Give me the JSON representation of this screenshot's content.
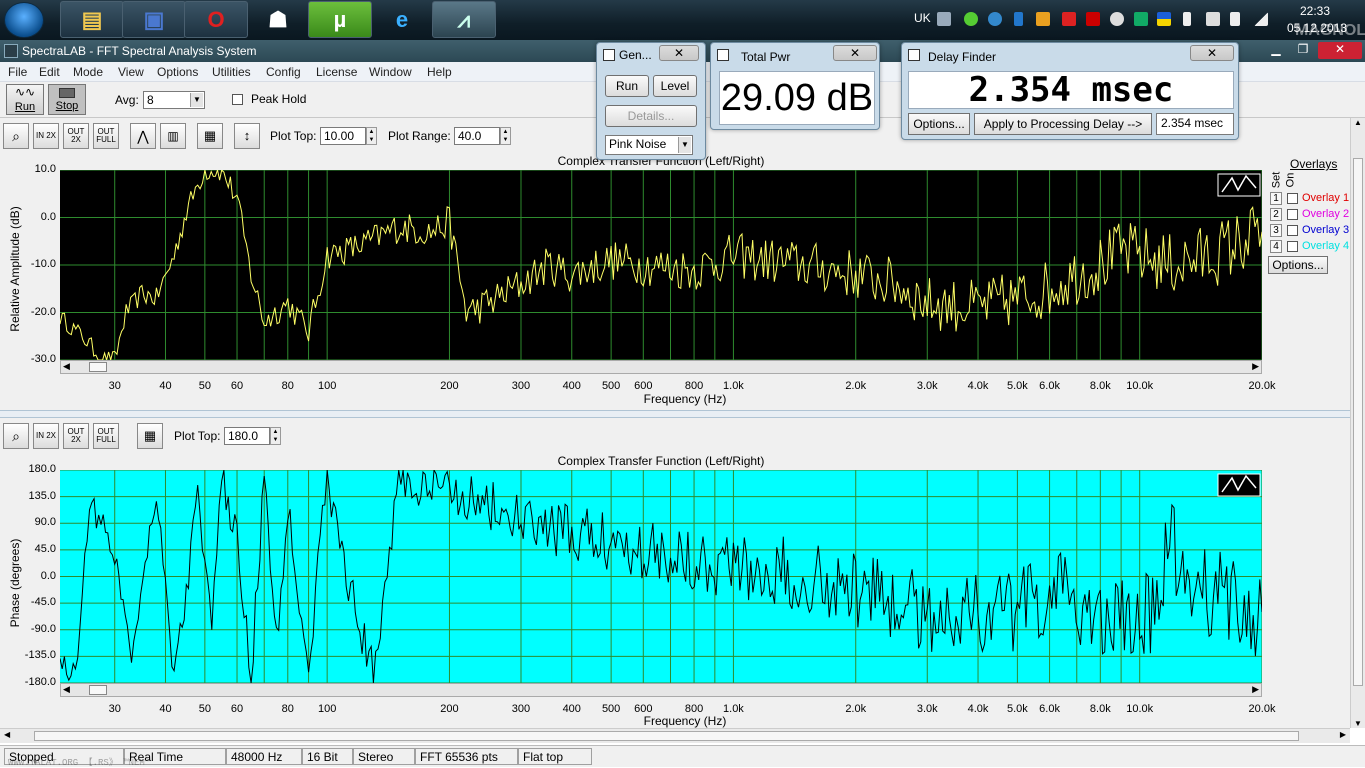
{
  "taskbar": {
    "clock_time": "22:33",
    "clock_date": "05.12.2013",
    "lang": "UK",
    "watermark": "MAGNOLIA"
  },
  "app": {
    "title": "SpectraLAB - FFT Spectral Analysis System"
  },
  "menu": [
    "File",
    "Edit",
    "Mode",
    "View",
    "Options",
    "Utilities",
    "Config",
    "License",
    "Window",
    "Help"
  ],
  "toolbar": {
    "run_label": "Run",
    "stop_label": "Stop",
    "avg_label": "Avg:",
    "avg_value": "8",
    "peak_hold_label": "Peak Hold",
    "plot_top_label": "Plot Top:",
    "plot_top_value": "10.00",
    "plot_range_label": "Plot Range:",
    "plot_range_value": "40.0",
    "plot2_top_value": "180.0",
    "zoom_in": "IN 2X",
    "zoom_out": "OUT 2X",
    "zoom_full": "OUT FULL"
  },
  "plot1": {
    "title": "Complex Transfer Function (Left/Right)",
    "ylabel": "Relative Amplitude (dB)",
    "xlabel": "Frequency (Hz)"
  },
  "plot2": {
    "title": "Complex Transfer Function (Left/Right)",
    "ylabel": "Phase (degrees)",
    "xlabel": "Frequency (Hz)"
  },
  "overlays": {
    "title": "Overlays",
    "set_label": "Set",
    "on_label": "On",
    "options_label": "Options...",
    "items": [
      {
        "num": "1",
        "name": "Overlay 1",
        "color": "#e00000"
      },
      {
        "num": "2",
        "name": "Overlay 2",
        "color": "#e000e0"
      },
      {
        "num": "3",
        "name": "Overlay 3",
        "color": "#0000d0"
      },
      {
        "num": "4",
        "name": "Overlay 4",
        "color": "#00e0e0"
      }
    ]
  },
  "generator": {
    "title": "Gen...",
    "run": "Run",
    "level": "Level",
    "details": "Details...",
    "noise": "Pink Noise"
  },
  "total_pwr": {
    "title": "Total Pwr",
    "value": "29.09 dB"
  },
  "delay": {
    "title": "Delay Finder",
    "value": "2.354 msec",
    "options": "Options...",
    "apply": "Apply to Processing Delay -->",
    "result": "2.354 msec"
  },
  "status": [
    "Stopped",
    "Real Time",
    "48000 Hz",
    "16 Bit",
    "Stereo",
    "FFT 65536 pts",
    "Flat top"
  ],
  "status_watermark": "WWW.YALAT.ORG 【.RS》 ™NEM™",
  "chart_data": [
    {
      "type": "line",
      "title": "Complex Transfer Function (Left/Right)",
      "xlabel": "Frequency (Hz)",
      "ylabel": "Relative Amplitude (dB)",
      "xscale": "log",
      "xlim": [
        22,
        20000
      ],
      "ylim": [
        -30,
        10
      ],
      "yticks": [
        "10.0",
        "0.0",
        "-10.0",
        "-20.0",
        "-30.0"
      ],
      "xticks": [
        "30",
        "40",
        "50",
        "60",
        "80",
        "100",
        "200",
        "300",
        "400",
        "500",
        "600",
        "800",
        "1.0k",
        "2.0k",
        "3.0k",
        "4.0k",
        "5.0k",
        "6.0k",
        "8.0k",
        "10.0k",
        "20.0k"
      ],
      "background": "#000000",
      "gridcolor": "#2e8b2e",
      "linecolor": "#ffff66",
      "series": [
        {
          "x": [
            22,
            25,
            28,
            30,
            32,
            35,
            38,
            42,
            45,
            48,
            50,
            55,
            60,
            65,
            70,
            80,
            90,
            100,
            120,
            150,
            180,
            200,
            220,
            250,
            300,
            350,
            400,
            500,
            600,
            800,
            1000,
            1200,
            1500,
            2000,
            2500,
            3000,
            4000,
            5000,
            6000,
            7000,
            8000,
            9000,
            10000,
            12000,
            15000,
            18000,
            20000
          ],
          "y": [
            -21,
            -25,
            -30,
            -30,
            -20,
            -16,
            -17,
            -8,
            1,
            7,
            10,
            10,
            4,
            -12,
            -22,
            -18,
            -24,
            -8,
            -6,
            -2,
            -3,
            -1,
            -20,
            -18,
            -14,
            -10,
            -12,
            -9,
            -10,
            -11,
            -8,
            -9,
            -10,
            -12,
            -14,
            -18,
            -19,
            -17,
            -15,
            -12,
            -10,
            -7,
            -8,
            -10,
            -8,
            -5,
            -3
          ]
        }
      ]
    },
    {
      "type": "line",
      "title": "Complex Transfer Function (Left/Right)",
      "xlabel": "Frequency (Hz)",
      "ylabel": "Phase (degrees)",
      "xscale": "log",
      "xlim": [
        22,
        20000
      ],
      "ylim": [
        -180,
        180
      ],
      "yticks": [
        "180.0",
        "135.0",
        "90.0",
        "45.0",
        "0.0",
        "-45.0",
        "-90.0",
        "-135.0",
        "-180.0"
      ],
      "xticks": [
        "30",
        "40",
        "50",
        "60",
        "80",
        "100",
        "200",
        "300",
        "400",
        "500",
        "600",
        "800",
        "1.0k",
        "2.0k",
        "3.0k",
        "4.0k",
        "5.0k",
        "6.0k",
        "8.0k",
        "10.0k",
        "20.0k"
      ],
      "background": "#00ffff",
      "gridcolor": "#2e8b2e",
      "linecolor": "#000000",
      "series": [
        {
          "x": [
            22,
            24,
            26,
            30,
            33,
            38,
            42,
            45,
            48,
            52,
            55,
            60,
            65,
            70,
            75,
            80,
            90,
            100,
            110,
            130,
            150,
            170,
            200,
            250,
            300,
            400,
            500,
            700,
            1000,
            1500,
            2000,
            3000,
            4000,
            5000,
            6000,
            8000,
            10000,
            12000,
            15000,
            20000
          ],
          "y": [
            -140,
            -170,
            130,
            40,
            -130,
            150,
            -170,
            -30,
            150,
            -100,
            170,
            60,
            -170,
            170,
            -120,
            120,
            -150,
            170,
            20,
            -170,
            170,
            140,
            150,
            120,
            90,
            70,
            60,
            40,
            20,
            0,
            -20,
            -60,
            -60,
            -60,
            -30,
            -60,
            -100,
            40,
            -30,
            -60
          ]
        }
      ]
    }
  ]
}
